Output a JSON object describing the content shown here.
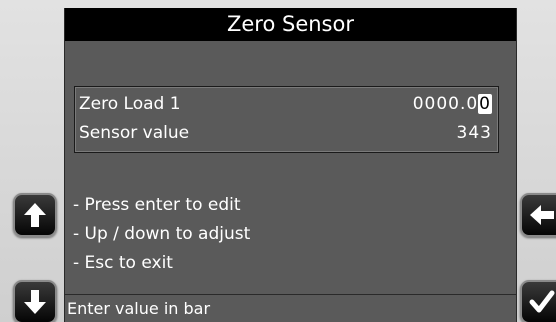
{
  "header": {
    "title": "Zero Sensor"
  },
  "fields": [
    {
      "label": "Zero Load 1",
      "value_main": "0000.0",
      "value_cursor": "0"
    },
    {
      "label": "Sensor value",
      "value": "343"
    }
  ],
  "instructions": [
    "- Press enter to edit",
    "- Up / down to adjust",
    "- Esc to exit"
  ],
  "status": {
    "message": "Enter value in bar"
  },
  "buttons": {
    "up": "arrow-up-icon",
    "down": "arrow-down-icon",
    "back": "arrow-left-icon",
    "enter": "checkmark-icon"
  }
}
